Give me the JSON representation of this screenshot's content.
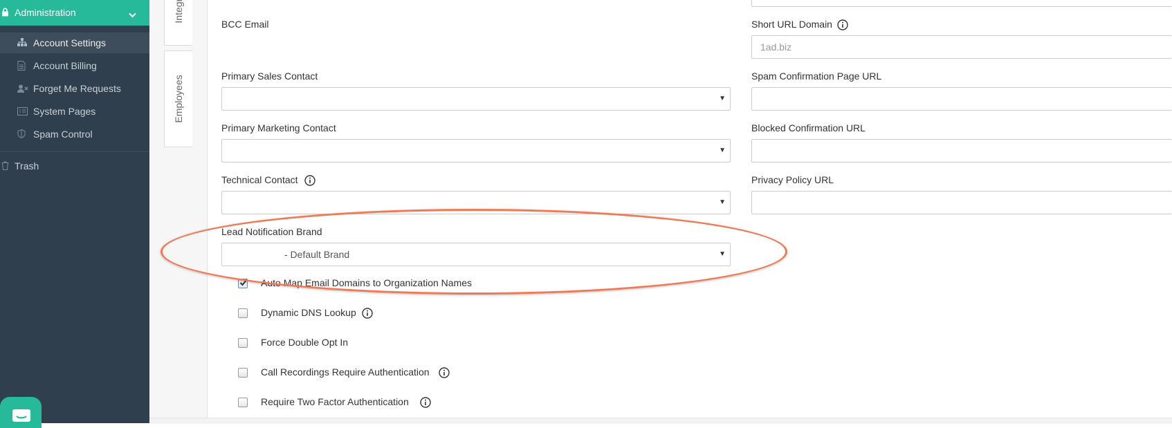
{
  "sidebar": {
    "section_title": "Administration",
    "items": [
      {
        "label": "Account Settings",
        "icon": "sitemap-icon",
        "active": true
      },
      {
        "label": "Account Billing",
        "icon": "document-icon"
      },
      {
        "label": "Forget Me Requests",
        "icon": "user-remove-icon"
      },
      {
        "label": "System Pages",
        "icon": "list-icon"
      },
      {
        "label": "Spam Control",
        "icon": "shield-icon"
      }
    ],
    "trash_label": "Trash"
  },
  "tabs": {
    "integrations": "Integrations",
    "employees": "Employees"
  },
  "form": {
    "bcc_email_label": "BCC Email",
    "short_url_label": "Short URL Domain",
    "short_url_value": "1ad.biz",
    "primary_sales_label": "Primary Sales Contact",
    "spam_confirmation_label": "Spam Confirmation Page URL",
    "primary_marketing_label": "Primary Marketing Contact",
    "blocked_confirmation_label": "Blocked Confirmation URL",
    "technical_contact_label": "Technical Contact",
    "privacy_policy_label": "Privacy Policy URL",
    "lead_notification_label": "Lead Notification Brand",
    "lead_notification_value": "- Default Brand"
  },
  "checkboxes": [
    {
      "label": "Auto Map Email Domains to Organization Names",
      "checked": true
    },
    {
      "label": "Dynamic DNS Lookup",
      "checked": false,
      "info": true
    },
    {
      "label": "Force Double Opt In",
      "checked": false
    },
    {
      "label": "Call Recordings Require Authentication",
      "checked": false,
      "info": true
    },
    {
      "label": "Require Two Factor Authentication",
      "checked": false,
      "info": true
    }
  ],
  "colors": {
    "accent": "#26b99a",
    "sidebar_bg": "#2f3f4d",
    "highlight": "#f07a55"
  }
}
